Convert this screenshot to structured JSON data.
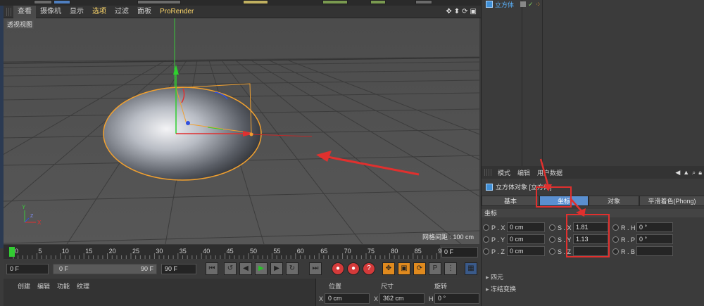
{
  "viewport_menu": {
    "items": [
      "查看",
      "摄像机",
      "显示",
      "选项",
      "过滤",
      "面板",
      "ProRender"
    ],
    "selected": "选项",
    "view_label": "透视视图",
    "grid_distance": "网格间距 : 100 cm"
  },
  "timeline": {
    "ticks": [
      "0",
      "5",
      "10",
      "15",
      "20",
      "25",
      "30",
      "35",
      "40",
      "45",
      "50",
      "55",
      "60",
      "65",
      "70",
      "75",
      "80",
      "85",
      "90"
    ],
    "end_field": "0 F"
  },
  "transport": {
    "current_frame": "0 F",
    "range_start": "0 F",
    "range_end": "90 F",
    "max_frame": "90 F"
  },
  "bottom_menu": {
    "items": [
      "创建",
      "编辑",
      "功能",
      "纹理"
    ]
  },
  "coord_panel": {
    "headers": [
      "位置",
      "尺寸",
      "旋转"
    ],
    "row_labels": [
      "X",
      "X",
      "H"
    ],
    "row_values": [
      "0 cm",
      "362 cm",
      "0 °"
    ]
  },
  "object_manager": {
    "object_name": "立方体"
  },
  "attributes": {
    "menu": [
      "模式",
      "编辑",
      "用户数据"
    ],
    "title": "立方体对象 [立方体]",
    "tabs": [
      "基本",
      "坐标",
      "对象",
      "平滑着色(Phong)"
    ],
    "selected_tab": "坐标",
    "section": "坐标",
    "rows": [
      {
        "p_label": "P . X",
        "p_value": "0 cm",
        "s_label": "S . X",
        "s_value": "1.81",
        "r_label": "R . H",
        "r_value": "0 °"
      },
      {
        "p_label": "P . Y",
        "p_value": "0 cm",
        "s_label": "S . Y",
        "s_value": "1.13",
        "r_label": "R . P",
        "r_value": "0 °"
      },
      {
        "p_label": "P . Z",
        "p_value": "0 cm",
        "s_label": "S . Z",
        "s_value": "",
        "r_label": "R . B",
        "r_value": ""
      }
    ],
    "collapsibles": [
      "四元",
      "冻结变换"
    ]
  },
  "colors": {
    "accent_red": "#e0302e",
    "selected_tab": "#5a8fd0",
    "ellipsoid_outline": "#f0a030"
  }
}
